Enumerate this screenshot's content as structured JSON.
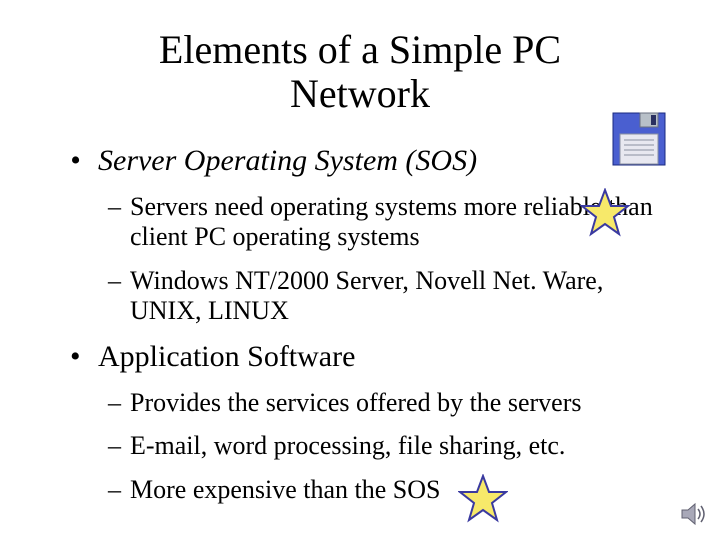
{
  "title_line1": "Elements of a Simple PC",
  "title_line2": "Network",
  "bullets": {
    "b1": "Server Operating System (SOS)",
    "b1a": "Servers need operating systems more reliable than client PC operating systems",
    "b1b": "Windows NT/2000 Server, Novell Net. Ware, UNIX, LINUX",
    "b2": "Application Software",
    "b2a": "Provides the services offered by the servers",
    "b2b": "E-mail, word processing, file sharing, etc.",
    "b2c": "More expensive than the SOS"
  },
  "icons": {
    "floppy": "floppy-disk-icon",
    "star": "star-icon",
    "speaker": "speaker-icon"
  }
}
